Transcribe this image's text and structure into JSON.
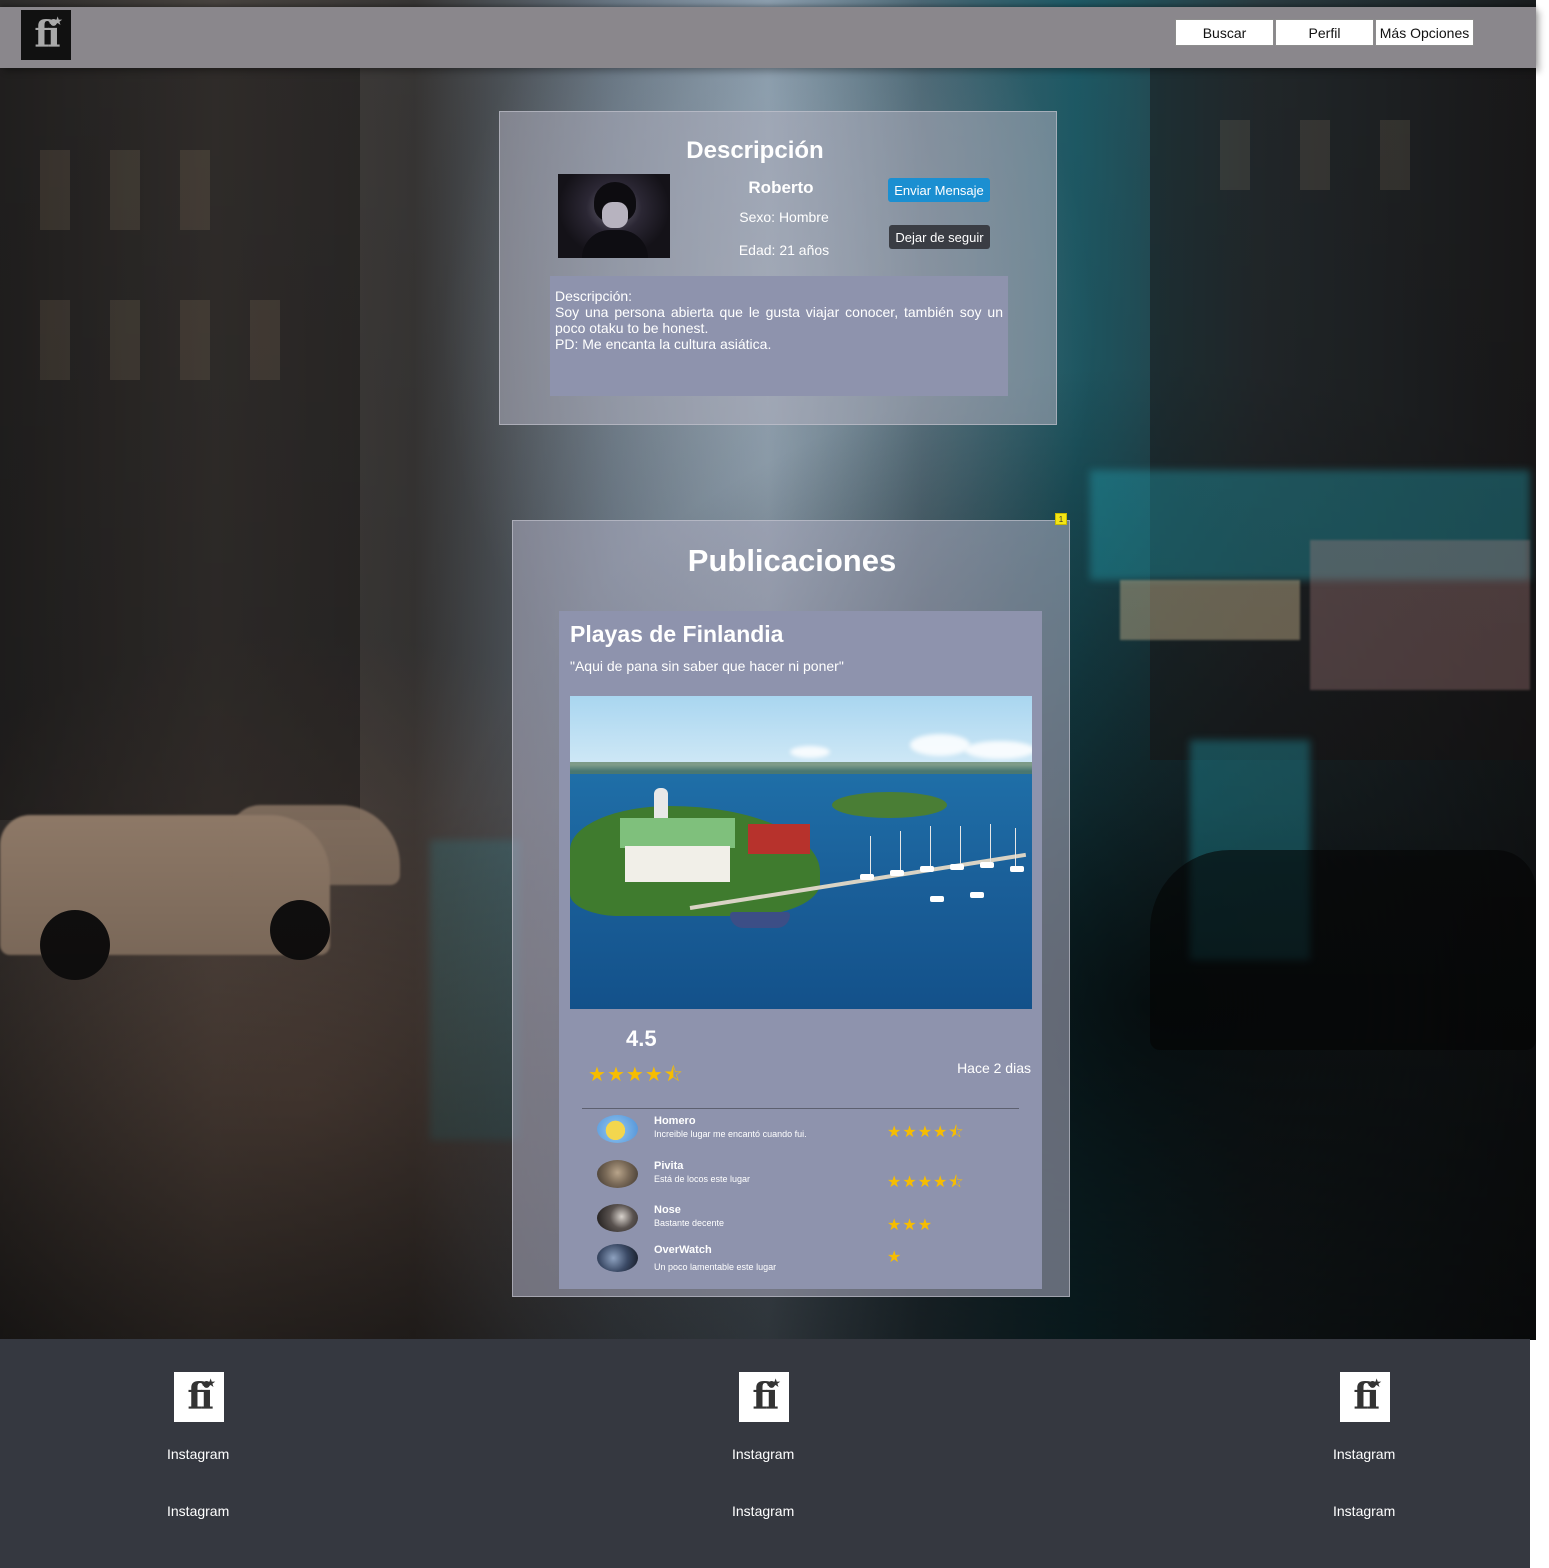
{
  "brand": {
    "logo_text": "fi"
  },
  "nav": {
    "items": [
      "Buscar",
      "Perfil",
      "Más Opciones"
    ]
  },
  "profile": {
    "section_title": "Descripción",
    "name": "Roberto",
    "sex": "Sexo: Hombre",
    "age": "Edad: 21 años",
    "send_message": "Enviar Mensaje",
    "unfollow": "Dejar de seguir",
    "description_label": "Descripción:",
    "description_text": "Soy una persona abierta que le gusta viajar conocer, también soy un poco otaku to be honest.",
    "description_ps": "PD: Me encanta la cultura asiática."
  },
  "publications": {
    "section_title": "Publicaciones",
    "badge": "1",
    "post": {
      "title": "Playas de Finlandia",
      "quote": "\"Aqui de pana sin saber que hacer ni poner\"",
      "rating": "4.5",
      "rating_value": 4.5,
      "posted": "Hace 2 dias",
      "comments": [
        {
          "name": "Homero",
          "text": "Increible lugar me encantó cuando fui.",
          "stars": 4.5,
          "stars_glyphs": "★★★★⯪"
        },
        {
          "name": "Pivita",
          "text": "Está de locos este lugar",
          "stars": 4.5,
          "stars_glyphs": "★★★★⯪"
        },
        {
          "name": "Nose",
          "text": "Bastante decente",
          "stars": 3,
          "stars_glyphs": "★★★"
        },
        {
          "name": "OverWatch",
          "text": "Un poco lamentable este lugar",
          "stars": 1,
          "stars_glyphs": "★"
        }
      ]
    }
  },
  "footer": {
    "columns": [
      {
        "links": [
          "Instagram",
          "Instagram"
        ]
      },
      {
        "links": [
          "Instagram",
          "Instagram"
        ]
      },
      {
        "links": [
          "Instagram",
          "Instagram"
        ]
      }
    ]
  },
  "colors": {
    "accent_blue": "#1b8fd1",
    "dark_button": "#3a3d44",
    "star_yellow": "#f7bd00",
    "footer_bg": "#353840",
    "topbar_bg": "#8a878c",
    "panel_bg": "#8e93ad"
  }
}
